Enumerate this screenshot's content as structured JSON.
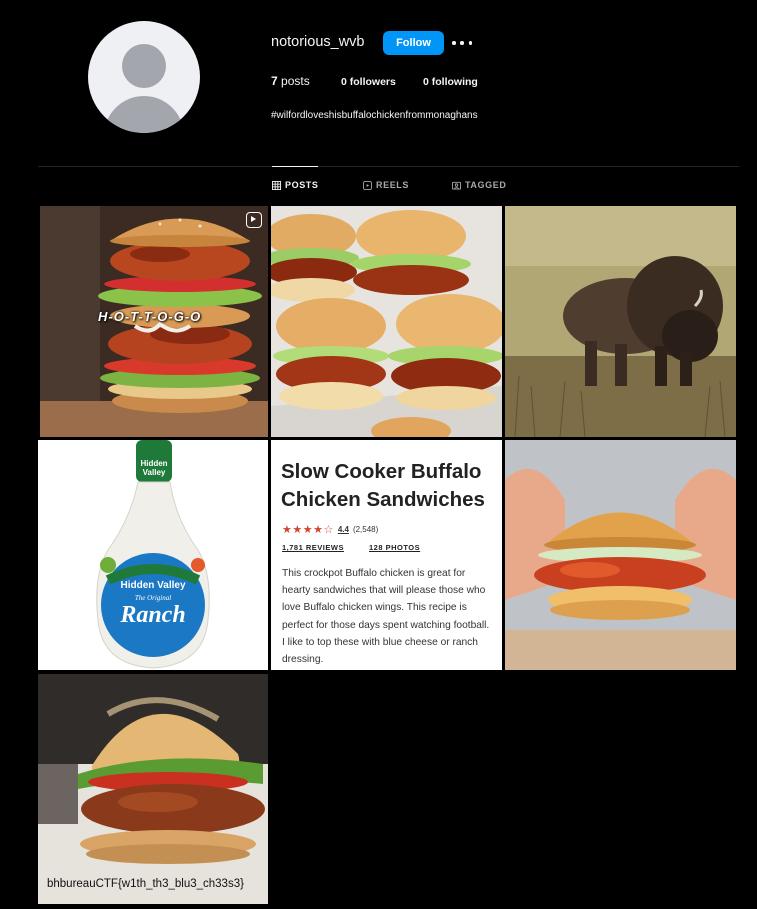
{
  "profile": {
    "username": "notorious_wvb",
    "follow_label": "Follow",
    "posts_count": "7",
    "posts_label": " posts",
    "followers": "0 followers",
    "following": "0 following",
    "bio": "#wilfordloveshisbuffalochickenfrommonaghans"
  },
  "tabs": [
    {
      "label": "POSTS",
      "icon": "grid-icon"
    },
    {
      "label": "REELS",
      "icon": "reels-icon"
    },
    {
      "label": "TAGGED",
      "icon": "tag-icon"
    }
  ],
  "posts": [
    {
      "subject": "stacked-buffalo-chicken-burger",
      "overlay_text": "H-O-T-T-O-G-O",
      "icon": "reels-icon"
    },
    {
      "subject": "buffalo-chicken-sliders"
    },
    {
      "subject": "bison"
    },
    {
      "subject": "hidden-valley-ranch-bottle",
      "label_brand": "Hidden Valley",
      "label_tagline": "The Original",
      "label_product": "Ranch"
    },
    {
      "subject": "recipe-card",
      "title": "Slow Cooker Buffalo Chicken Sandwiches",
      "rating_value": "4.4",
      "rating_count": "(2,548)",
      "reviews": "1,781 REVIEWS",
      "photos": "128 PHOTOS",
      "description": "This crockpot Buffalo chicken is great for hearty sandwiches that will please those who love Buffalo chicken wings. This recipe is perfect for those days spent watching football. I like to top these with blue cheese or ranch dressing."
    },
    {
      "subject": "hands-holding-buffalo-chicken-sandwich"
    },
    {
      "subject": "buffalo-chicken-sandwich-ctf",
      "caption": "bhbureauCTF{w1th_th3_blu3_ch33s3}"
    }
  ],
  "colors": {
    "background": "#000000",
    "follow_button": "#0095f6",
    "divider": "#262626",
    "muted_text": "#a8a8a8",
    "star": "#d2452e"
  }
}
